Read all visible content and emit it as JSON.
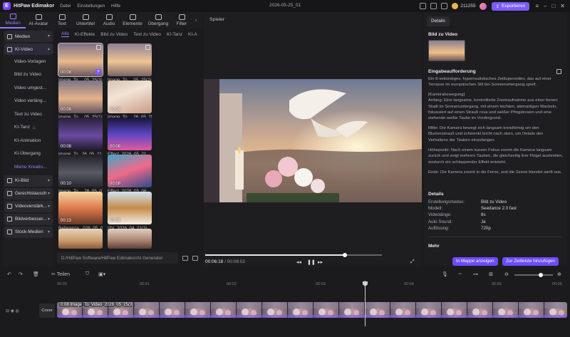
{
  "titlebar": {
    "app_name": "HitPaw Edimakor",
    "menu": [
      "Datei",
      "Einstellungen",
      "Hilfe"
    ],
    "project_name": "2026-05-25_01",
    "coins": "211255",
    "export_label": "Exportieren"
  },
  "toolbar": [
    {
      "label": "Medien",
      "icon": "media-icon",
      "active": true
    },
    {
      "label": "AI-Avatar",
      "icon": "avatar-icon"
    },
    {
      "label": "Text",
      "icon": "text-icon"
    },
    {
      "label": "Untertitel",
      "icon": "subtitle-icon"
    },
    {
      "label": "Audio",
      "icon": "audio-icon"
    },
    {
      "label": "Elemente",
      "icon": "elements-icon"
    },
    {
      "label": "Übergang",
      "icon": "transition-icon"
    },
    {
      "label": "Filter",
      "icon": "filter-icon"
    }
  ],
  "sidebar": {
    "groups": {
      "medien": "Medien",
      "ki_video": "KI-Video",
      "ki_bild": "KI-Bild",
      "gesichtstausch": "Gesichtstausch",
      "videoverstaerker": "Videoverstärk...",
      "bildverbesserer": "Bildverbesser...",
      "stock": "Stock-Medien"
    },
    "ki_video_items": [
      "Video-Vorlagen",
      "Bild zu Video",
      "Video umgest...",
      "Video verläng...",
      "Text zu Video",
      "KI-Tanz",
      "KI-Animation",
      "KI-Übergang",
      "Meine Kreatio..."
    ]
  },
  "media_tabs": [
    "Alle",
    "KI-Effekte",
    "Bild zu Video",
    "Text zu Video",
    "KI-Tanz",
    "KI-A"
  ],
  "media_items": [
    {
      "duration": "00:08",
      "caption": "Image_To_...05_25(3)"
    },
    {
      "duration": "",
      "caption": "Image_To_...05_25(2)"
    },
    {
      "duration": "00:08",
      "caption": "Image_To_...05_25(1)"
    },
    {
      "duration": "00:08",
      "caption": "Image_To_...26_05_25"
    },
    {
      "duration": "00:08",
      "caption": "Image_To...26_05_21"
    },
    {
      "duration": "00:08",
      "caption": "Effect_2026_05_21"
    },
    {
      "duration": "00:10",
      "caption": "Image_To_...26_05_07"
    },
    {
      "duration": "00:08",
      "caption": "Effect_2026_05_06"
    },
    {
      "duration": "00:13",
      "caption": "Reference...026_05_06"
    },
    {
      "duration": "00:08",
      "caption": "I2V_2026_04_21(3)"
    },
    {
      "duration": "",
      "caption": ""
    },
    {
      "duration": "",
      "caption": ""
    }
  ],
  "path": "D:/HitPaw Software/HitPaw Edimakor/AI Generator",
  "player": {
    "title": "Spieler",
    "current_time": "00:06:18",
    "total_time": "/ 00:08:02",
    "progress": 0.79
  },
  "details": {
    "tab": "Details",
    "section_image": "Bild zu Video",
    "section_prompt": "Eingabeaufforderung",
    "prompt_paragraphs": [
      "Ein 8-sekündiges, hyperrealistisches Zeitlupenvideo, das auf einer Terrasse im europäischen Stil bei Sonnenuntergang spielt.",
      "[Kamerabewegung]\nAnfang: Eine langsame, kontrollierte Zoomaufnahme aus einer fernen Stadt im Sonnenuntergang, mit einem leichten, atemartigen Wackeln, fokussiert auf einen Strauß rosa und weißer Pfingstrosen und eine stehende weiße Taube im Vordergrund.",
      "Mitte: Die Kamera bewegt sich langsam kreisförmig um den Blumenstrauß und schwenkt leicht nach oben, um Details des Verhaltens der Tauben einzufangen.",
      "Höhepunkt: Nach einem kurzen Fokus zoomt die Kamera langsam zurück und zeigt mehrere Tauben, die gleichzeitig ihre Flügel ausbreiten, wodurch ein schleppender Effekt entsteht.",
      "Ende: Die Kamera zoomt in die Ferne, und die Szene blendet sanft aus."
    ],
    "section_details": "Details",
    "rows": [
      {
        "key": "Erstellungsmodus:",
        "value": "Bild zu Video"
      },
      {
        "key": "Modell:",
        "value": "Seedance 2.0 fast"
      },
      {
        "key": "Videolänge:",
        "value": "8s"
      },
      {
        "key": "Auto Sound:",
        "value": "Ja"
      },
      {
        "key": "Auflösung:",
        "value": "720p"
      }
    ],
    "section_more": "Mehr",
    "btn_folder": "In Mappe anzeigen",
    "btn_timeline": "Zur Zeitleiste hinzufügen"
  },
  "timeline": {
    "split_label": "Teilen",
    "ruler": [
      "00:00",
      "00:01",
      "00:02",
      "00:03",
      "00:04",
      "00:05",
      "00:06"
    ],
    "cover_label": "Cover",
    "clip_label": "0:08 Image_To_Video_2026_05_25(3)"
  },
  "colors": {
    "accent": "#7b5cff",
    "accent_text": "#9a7bff"
  }
}
